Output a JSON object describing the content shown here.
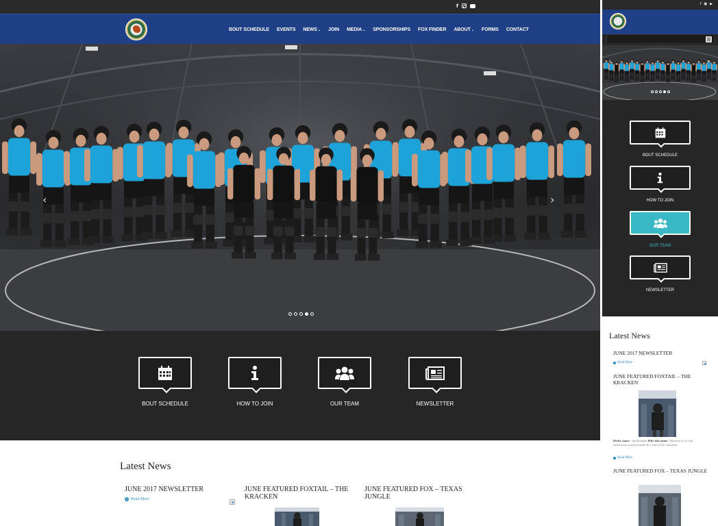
{
  "nav": {
    "items": [
      {
        "label": "BOUT SCHEDULE",
        "caret": false
      },
      {
        "label": "EVENTS",
        "caret": false
      },
      {
        "label": "NEWS",
        "caret": true
      },
      {
        "label": "JOIN",
        "caret": false
      },
      {
        "label": "MEDIA",
        "caret": true
      },
      {
        "label": "SPONSORSHIPS",
        "caret": false
      },
      {
        "label": "FOX FINDER",
        "caret": false
      },
      {
        "label": "ABOUT",
        "caret": true
      },
      {
        "label": "FORMS",
        "caret": false
      },
      {
        "label": "CONTACT",
        "caret": false
      }
    ],
    "caret_glyph": "⌄"
  },
  "social": {
    "facebook": "f",
    "instagram_icon": "instagram-icon",
    "youtube_icon": "youtube-icon"
  },
  "hero": {
    "slide_count": 5,
    "active_slide": 4,
    "prev_arrow": "‹",
    "next_arrow": "›"
  },
  "features": [
    {
      "label": "BOUT SCHEDULE",
      "icon": "calendar-icon"
    },
    {
      "label": "HOW TO JOIN",
      "icon": "info-icon"
    },
    {
      "label": "OUR TEAM",
      "icon": "team-icon"
    },
    {
      "label": "NEWSLETTER",
      "icon": "newspaper-icon"
    }
  ],
  "news": {
    "title": "Latest News",
    "read_more": "Read More",
    "posts": [
      {
        "title": "JUNE 2017 NEWSLETTER"
      },
      {
        "title": "JUNE FEATURED FOXTAIL – THE KRACKEN"
      },
      {
        "title": "JUNE FEATURED FOX – TEXAS JUNGLE"
      }
    ]
  },
  "mobile": {
    "active_feature": 2,
    "excerpt": {
      "label1": "Derby name",
      "text1": " - the Kracken ",
      "label2": "Why this name",
      "text2": " - Because it's a cool underwater ocean monster & I want to be a monster."
    }
  },
  "colors": {
    "nav_blue": "#1f3f86",
    "dark": "#262626",
    "accent_teal": "#3ab8c6",
    "link_blue": "#2a8cc4"
  }
}
